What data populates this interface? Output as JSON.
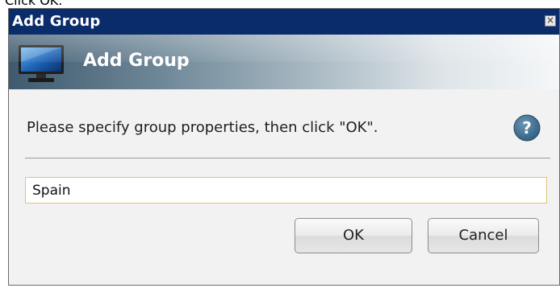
{
  "caption": "Click OK.",
  "dialog": {
    "title": "Add Group",
    "close_glyph": "×",
    "banner_title": "Add Group",
    "banner_icon": "monitor-icon",
    "instruction": "Please specify group properties, then click \"OK\".",
    "help_icon": "help-icon",
    "help_glyph": "?",
    "group_name_value": "Spain",
    "ok_label": "OK",
    "cancel_label": "Cancel"
  },
  "colors": {
    "titlebar": "#0b2c6b",
    "input_border": "#e3c27a",
    "help_circle": "#3d6f90"
  }
}
